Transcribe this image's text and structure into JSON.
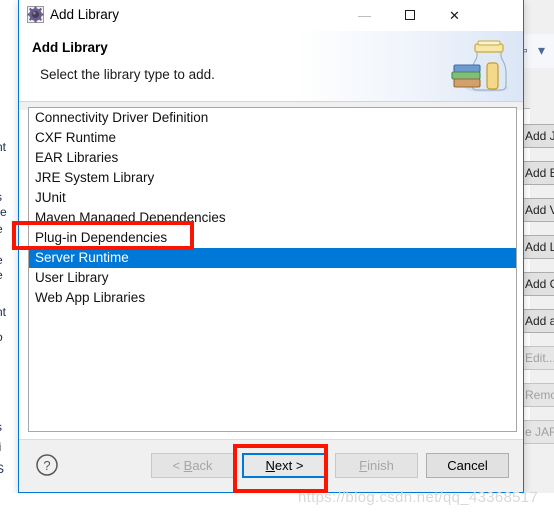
{
  "window": {
    "title": "Add Library",
    "icon": "gear-icon",
    "controls": {
      "minimize": "—",
      "maximize": "maximize-square",
      "close": "✕"
    }
  },
  "header": {
    "title": "Add Library",
    "subtitle": "Select the library type to add.",
    "icon": "library-jar-icon"
  },
  "library_list": {
    "items": [
      {
        "label": "Connectivity Driver Definition",
        "selected": false
      },
      {
        "label": "CXF Runtime",
        "selected": false
      },
      {
        "label": "EAR Libraries",
        "selected": false
      },
      {
        "label": "JRE System Library",
        "selected": false
      },
      {
        "label": "JUnit",
        "selected": false
      },
      {
        "label": "Maven Managed Dependencies",
        "selected": false
      },
      {
        "label": "Plug-in Dependencies",
        "selected": false
      },
      {
        "label": "Server Runtime",
        "selected": true
      },
      {
        "label": "User Library",
        "selected": false
      },
      {
        "label": "Web App Libraries",
        "selected": false
      }
    ]
  },
  "footer": {
    "help_icon": "question-mark-icon",
    "buttons": [
      {
        "label": "< Back",
        "state": "disabled"
      },
      {
        "label": "Next >",
        "state": "focused"
      },
      {
        "label": "Finish",
        "state": "disabled"
      },
      {
        "label": "Cancel",
        "state": "enabled"
      }
    ]
  },
  "annotations": {
    "selection_highlight": "red-rectangle-around-server-runtime",
    "next_highlight": "red-rectangle-around-next-button"
  },
  "watermark": {
    "text": "https://blog.csdn.net/qq_43368517"
  },
  "background": {
    "right_buttons": [
      {
        "label": "Add JARs...",
        "state": "enabled"
      },
      {
        "label": "Add External J",
        "state": "enabled"
      },
      {
        "label": "Add Variable...",
        "state": "enabled"
      },
      {
        "label": "Add Library...",
        "state": "enabled"
      },
      {
        "label": "Add Class Fol",
        "state": "enabled"
      },
      {
        "label": "Add al Class",
        "state": "enabled"
      },
      {
        "label": "Edit...",
        "state": "disabled"
      },
      {
        "label": "Remove",
        "state": "disabled"
      },
      {
        "label": "e JAR",
        "state": "disabled"
      }
    ],
    "left_fragments": [
      "r",
      "nt",
      "t",
      "s",
      "re",
      "e",
      "e",
      "e",
      "nt",
      "o",
      "s",
      "li",
      "S"
    ],
    "nav_icons": [
      "back-arrow-icon",
      "chevron-down-icon"
    ]
  },
  "colors": {
    "selection_blue": "#0078d7",
    "annotation_red": "#fb1400",
    "window_border": "#0078d7"
  }
}
